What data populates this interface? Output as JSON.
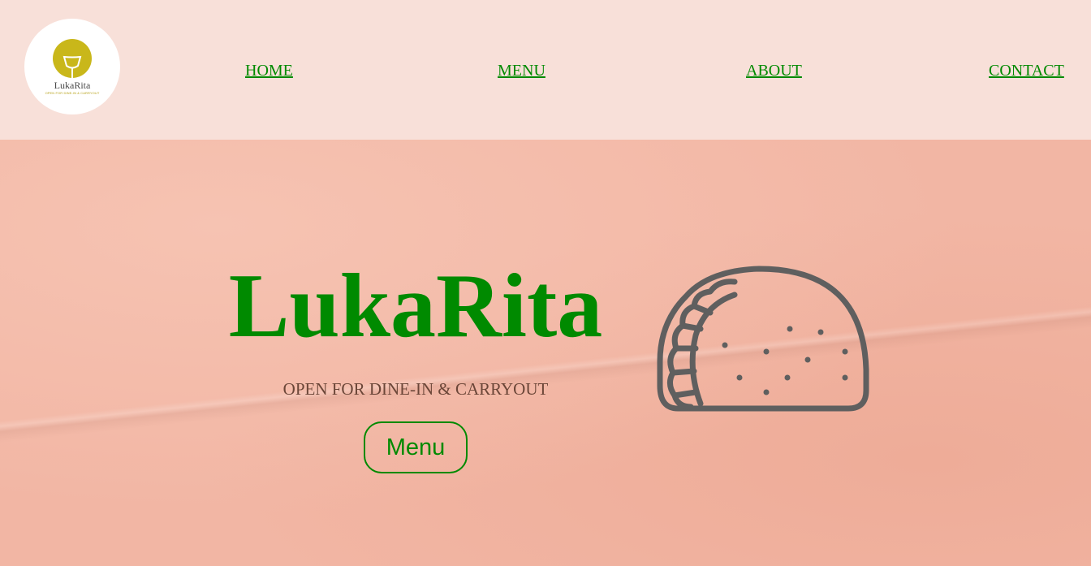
{
  "header": {
    "logo": {
      "name": "LukaRita",
      "tagline": "OPEN FOR DINE-IN & CARRYOUT",
      "icon": "margarita-glass-icon"
    },
    "nav": {
      "home": "HOME",
      "menu": "MENU",
      "about": "ABOUT",
      "contact": "CONTACT"
    }
  },
  "hero": {
    "title": "LukaRita",
    "subtitle": "OPEN FOR DINE-IN & CARRYOUT",
    "cta_label": "Menu",
    "illustration": "taco-icon"
  },
  "colors": {
    "accent_green": "#008a00",
    "header_bg": "#f8e0d9",
    "hero_bg": "#f2b6a4",
    "subtitle_brown": "#6b4638",
    "logo_gold": "#c9b71a",
    "taco_gray": "#5f5f5f"
  }
}
